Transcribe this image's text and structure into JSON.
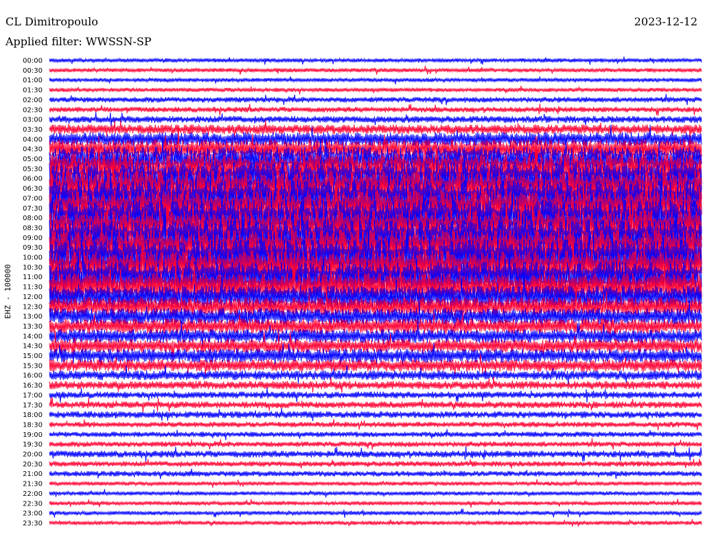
{
  "chart_data": {
    "type": "line",
    "title": "CL Dimitropoulo",
    "subtitle": "Applied filter: WWSSN-SP",
    "date": "2023-12-12",
    "ylabel": "EHZ - 100000",
    "row_labels": [
      "00:00",
      "00:30",
      "01:00",
      "01:30",
      "02:00",
      "02:30",
      "03:00",
      "03:30",
      "04:00",
      "04:30",
      "05:00",
      "05:30",
      "06:00",
      "06:30",
      "07:00",
      "07:30",
      "08:00",
      "08:30",
      "09:00",
      "09:30",
      "10:00",
      "10:30",
      "11:00",
      "11:30",
      "12:00",
      "12:30",
      "13:00",
      "13:30",
      "14:00",
      "14:30",
      "15:00",
      "15:30",
      "16:00",
      "16:30",
      "17:00",
      "17:30",
      "18:00",
      "18:30",
      "19:00",
      "19:30",
      "20:00",
      "20:30",
      "21:00",
      "21:30",
      "22:00",
      "22:30",
      "23:00",
      "23:30"
    ],
    "series_colors": [
      "#0000ff",
      "#ff0033"
    ],
    "trace_amplitude_levels": [
      3,
      3,
      3,
      3,
      4,
      4,
      5,
      7,
      10,
      14,
      18,
      22,
      24,
      26,
      26,
      26,
      26,
      26,
      26,
      26,
      26,
      24,
      22,
      20,
      16,
      14,
      12,
      11,
      10,
      10,
      10,
      9,
      7,
      6,
      5,
      5,
      5,
      4,
      4,
      4,
      5,
      4,
      4,
      3,
      3,
      3,
      3,
      3
    ],
    "grid": false
  }
}
